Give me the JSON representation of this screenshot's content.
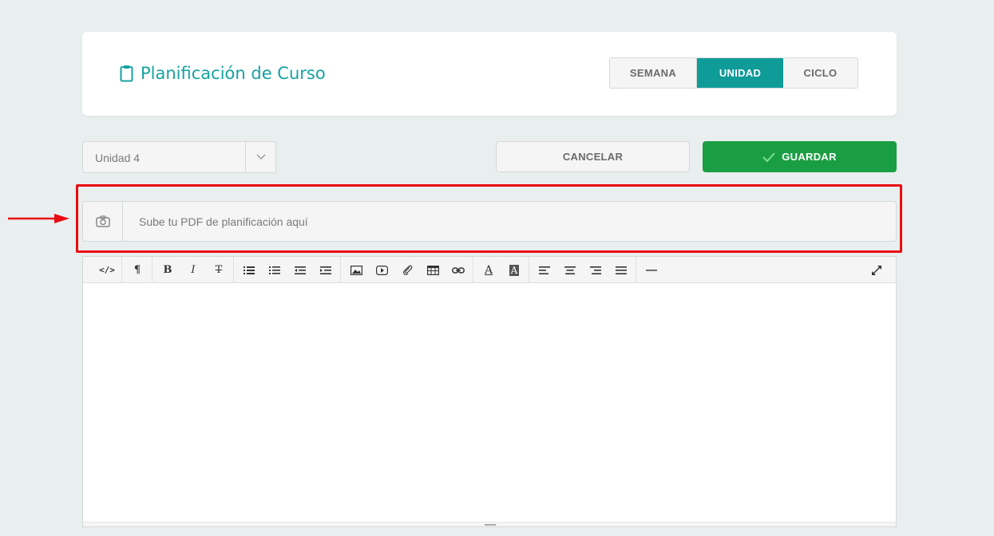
{
  "header": {
    "title": "Planificación de Curso",
    "tabs": [
      {
        "label": "SEMANA",
        "active": false
      },
      {
        "label": "UNIDAD",
        "active": true
      },
      {
        "label": "CICLO",
        "active": false
      }
    ]
  },
  "controls": {
    "unit_select_value": "Unidad 4",
    "cancel_label": "CANCELAR",
    "save_label": "GUARDAR"
  },
  "upload": {
    "placeholder": "Sube tu PDF de planificación aquí"
  },
  "toolbar": {
    "buttons": [
      "code-view",
      "paragraph-style",
      "bold",
      "italic",
      "strikethrough",
      "unordered-list",
      "ordered-list",
      "outdent",
      "indent",
      "insert-image",
      "insert-video",
      "attach-file",
      "insert-table",
      "insert-link",
      "text-color",
      "background-color",
      "align-left",
      "align-center",
      "align-right",
      "align-justify",
      "horizontal-rule",
      "fullscreen"
    ]
  },
  "colors": {
    "accent": "#0f9b98",
    "title": "#16a3a0",
    "save": "#1a9e43",
    "annotation": "#e80c12"
  }
}
